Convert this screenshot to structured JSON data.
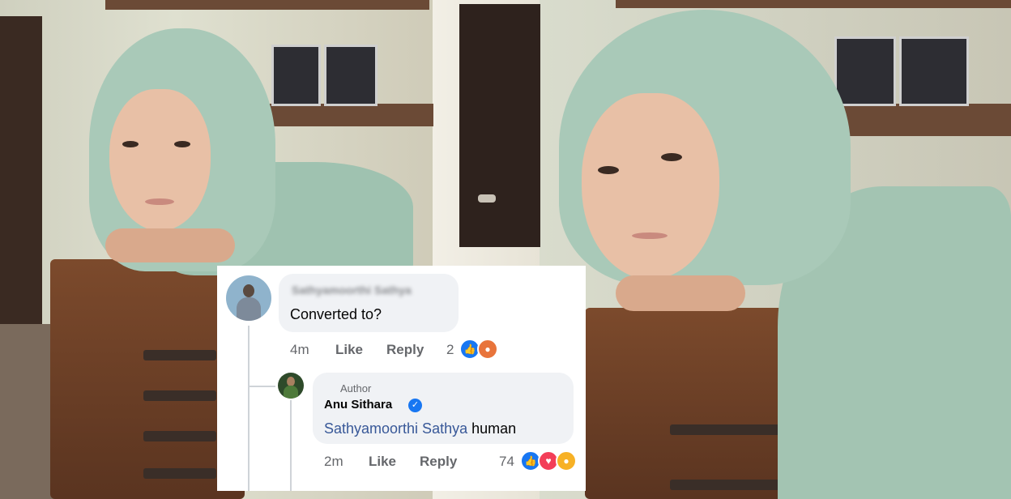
{
  "photo": {
    "subject": "woman-in-mint-dupatta",
    "palette": {
      "scarf": "#a9c9b8",
      "wood": "#6b4a36",
      "skin": "#e8c0a6",
      "wall": "#d9dccd"
    }
  },
  "comment_card": {
    "comment": {
      "author_name_blurred": "Sathyamoorthi Sathya",
      "text": "Converted to?",
      "time": "4m",
      "like_label": "Like",
      "reply_label": "Reply",
      "reaction_count": "2",
      "reactions": [
        "like",
        "angry"
      ]
    },
    "reply": {
      "author_badge": "Author",
      "author_name": "Anu Sithara",
      "mention": "Sathyamoorthi Sathya",
      "text": " human",
      "time": "2m",
      "like_label": "Like",
      "reply_label": "Reply",
      "reaction_count": "74",
      "reactions": [
        "like",
        "love",
        "haha"
      ]
    },
    "colors": {
      "facebook_blue": "#1877f2",
      "mention": "#385898",
      "meta_grey": "#65676b",
      "bubble": "#f0f2f5"
    }
  }
}
